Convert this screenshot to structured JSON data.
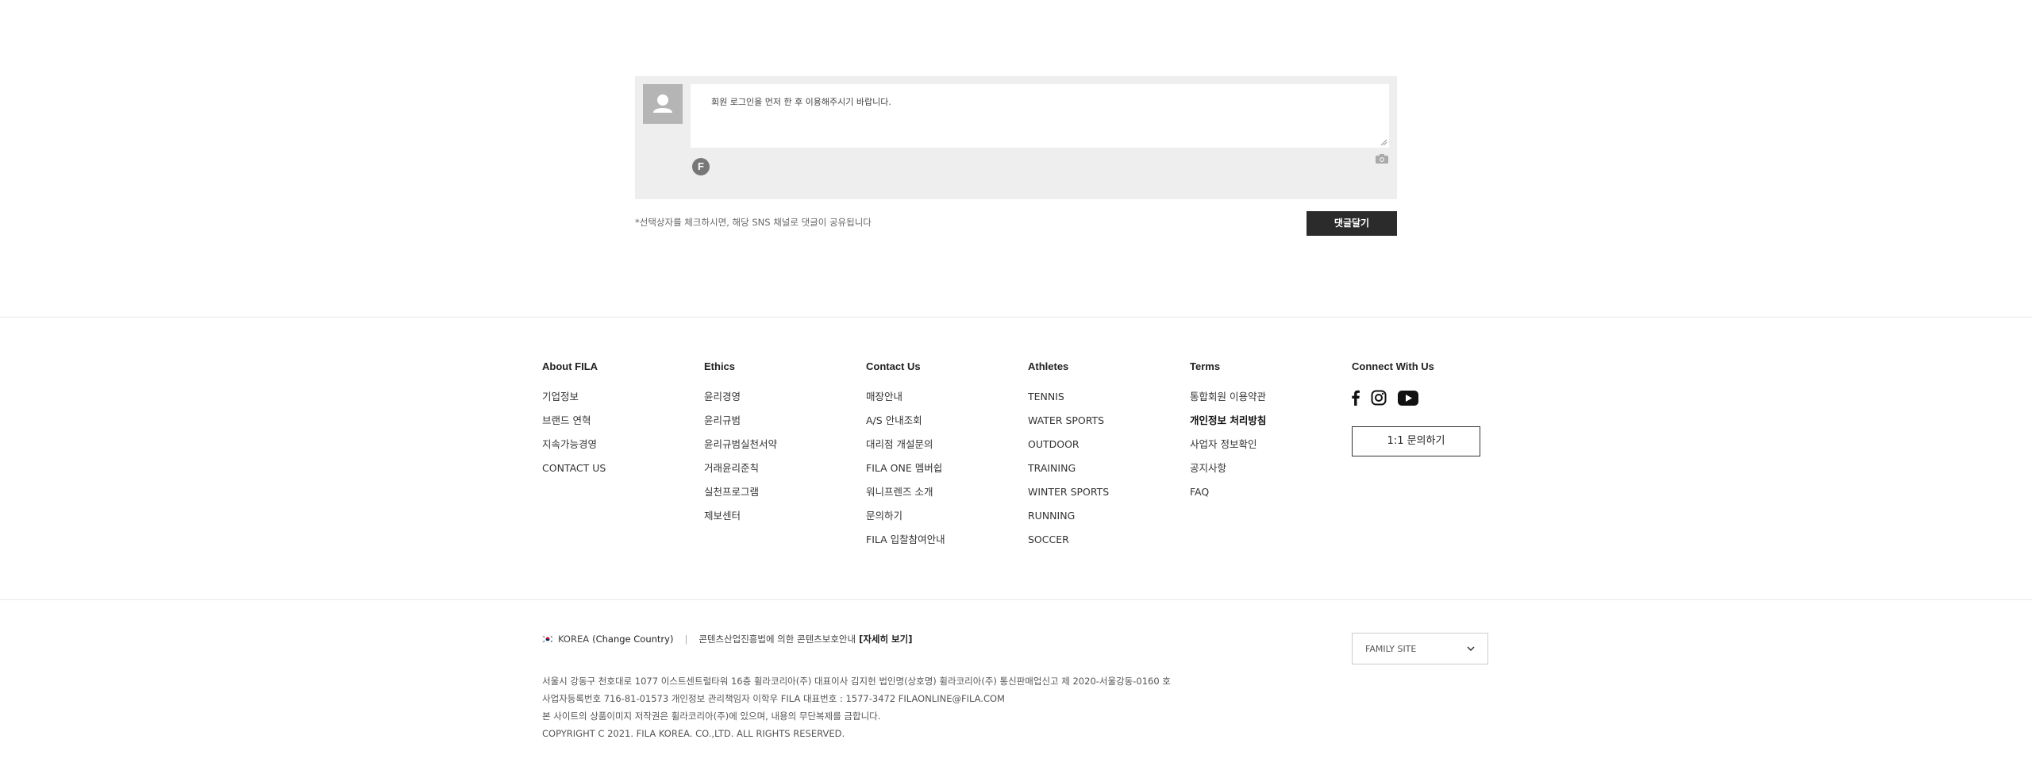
{
  "comment": {
    "placeholder": "회원 로그인을 먼저 한 후 이용해주시기 바랍니다.",
    "sns_notice": "*선택상자를 체크하시면, 해당 SNS 채널로 댓글이 공유됩니다",
    "submit_label": "댓글달기"
  },
  "footer": {
    "columns": [
      {
        "title": "About FILA",
        "items": [
          "기업정보",
          "브랜드 연혁",
          "지속가능경영",
          "CONTACT US"
        ]
      },
      {
        "title": "Ethics",
        "items": [
          "윤리경영",
          "윤리규범",
          "윤리규범실천서약",
          "거래윤리준칙",
          "실천프로그램",
          "제보센터"
        ]
      },
      {
        "title": "Contact Us",
        "items": [
          "매장안내",
          "A/S 안내조회",
          "대리점 개설문의",
          "FILA ONE 멤버쉽",
          "워니프렌즈 소개",
          "문의하기",
          "FILA 입찰참여안내"
        ]
      },
      {
        "title": "Athletes",
        "items": [
          "TENNIS",
          "WATER SPORTS",
          "OUTDOOR",
          "TRAINING",
          "WINTER SPORTS",
          "RUNNING",
          "SOCCER"
        ]
      },
      {
        "title": "Terms",
        "items": [
          "통합회원 이용약관",
          "개인정보 처리방침",
          "사업자 정보확인",
          "공지사항",
          "FAQ"
        ]
      }
    ],
    "connect": {
      "title": "Connect With Us",
      "social_icons": [
        "facebook-icon",
        "instagram-icon",
        "youtube-icon"
      ],
      "inquiry_label": "1:1 문의하기"
    },
    "country": {
      "name": "KOREA",
      "change_label": "(Change Country)",
      "content_notice": "콘텐츠산업진흥법에 의한 콘텐츠보호안내",
      "details_link": "[자세히 보기]"
    },
    "family_site": "FAMILY SITE",
    "company_info": [
      "서울시 강동구 천호대로 1077 이스트센트럴타워 16층 휠라코리아(주)   대표이사 김지헌   법인명(상호명) 휠라코리아(주)   통신판매업신고 제 2020-서울강동-0160 호",
      "사업자등록번호 716-81-01573 개인정보 관리책임자 이학우   FILA 대표번호 : 1577-3472   FILAONLINE@FILA.COM",
      "본 사이트의 상품이미지 저작권은 휠라코리아(주)에 있으며, 내용의 무단복제를 금합니다.",
      "COPYRIGHT C 2021. FILA KOREA. CO.,LTD. ALL RIGHTS RESERVED."
    ]
  },
  "colors": {
    "button_dark": "#2b2b2b",
    "comment_bg": "#eeeeee",
    "avatar_bg": "#b5b5b5"
  }
}
